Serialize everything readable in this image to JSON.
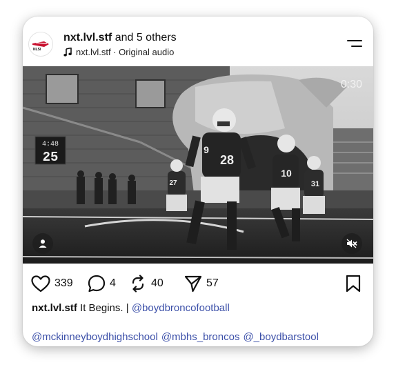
{
  "post": {
    "username": "nxt.lvl.stf",
    "collab_text": "and 5 others",
    "audio_label": "nxt.lvl.stf · Original audio",
    "avatar_logo_text": "NLSI"
  },
  "video": {
    "timer": "0:30",
    "scoreboard_time": "4:48",
    "scoreboard_value": "25",
    "jersey_numbers": [
      "9",
      "28",
      "10",
      "31",
      "27"
    ]
  },
  "actions": {
    "likes": "339",
    "comments": "4",
    "reposts": "40",
    "shares": "57"
  },
  "caption": {
    "username": "nxt.lvl.stf",
    "text": "It Begins. |",
    "mention": "@boydbroncofootball"
  },
  "mentions": [
    "@mckinneyboydhighschool",
    "@mbhs_broncos",
    "@_boydbarstool"
  ],
  "colors": {
    "mention": "#3b4fa8",
    "text": "#111111",
    "card_bg": "#ffffff"
  },
  "icons": {
    "like": "heart-icon",
    "comment": "comment-bubble-icon",
    "repost": "repost-arrows-icon",
    "share": "send-paper-plane-icon",
    "save": "bookmark-icon",
    "menu": "menu-lines-icon",
    "audio": "music-note-icon",
    "tag": "person-tag-icon",
    "mute": "speaker-muted-icon"
  }
}
